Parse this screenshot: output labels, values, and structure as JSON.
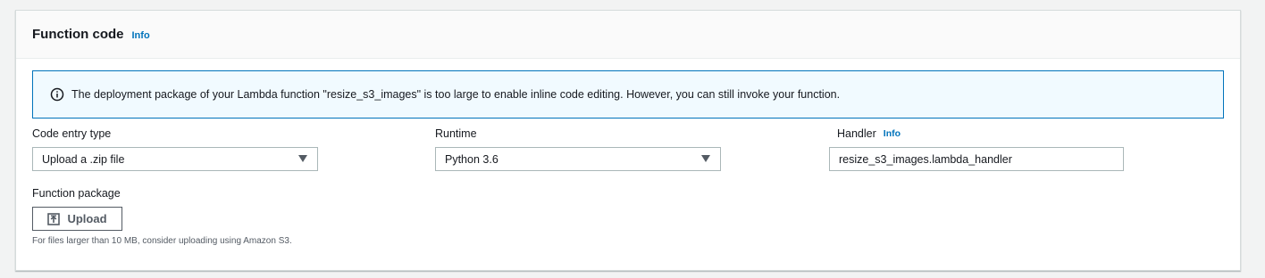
{
  "panel": {
    "title": "Function code",
    "info_label": "Info"
  },
  "alert": {
    "icon": "info-circle-icon",
    "text": "The deployment package of your Lambda function \"resize_s3_images\" is too large to enable inline code editing. However, you can still invoke your function."
  },
  "code_entry": {
    "label": "Code entry type",
    "selected": "Upload a .zip file"
  },
  "runtime": {
    "label": "Runtime",
    "selected": "Python 3.6"
  },
  "handler": {
    "label": "Handler",
    "info_label": "Info",
    "value": "resize_s3_images.lambda_handler"
  },
  "function_package": {
    "label": "Function package",
    "upload_label": "Upload",
    "upload_icon": "upload-icon",
    "hint": "For files larger than 10 MB, consider uploading using Amazon S3."
  },
  "colors": {
    "accent": "#0073bb",
    "alert_background": "#f1faff",
    "page_background": "#f2f3f3"
  }
}
